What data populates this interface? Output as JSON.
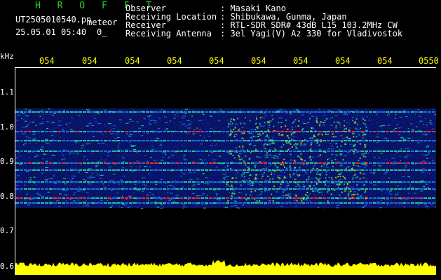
{
  "header": {
    "title": "H R O F F T",
    "file": "UT2505010540.pn",
    "mode": "meteor",
    "datetime": "25.05.01 05:40",
    "counter": "0_",
    "fields": [
      {
        "label": "Observer",
        "value": ": Masaki Kano"
      },
      {
        "label": "Receiving Location",
        "value": ": Shibukawa, Gunma, Japan"
      },
      {
        "label": "Receiver",
        "value": ": RTL-SDR SDR# 43dB L15 103.2MHz CW"
      },
      {
        "label": "Receiving Antenna",
        "value": ": 3el Yagi(V) Az 330 for Vladivostok"
      }
    ]
  },
  "axis": {
    "unit": "kHz",
    "x_ticks": [
      "054",
      "054",
      "054",
      "054",
      "054",
      "054",
      "054",
      "054",
      "054",
      "0550"
    ],
    "y_ticks": [
      "1.1",
      "1.0",
      "0.9",
      "0.8",
      "0.7",
      "0.6"
    ]
  },
  "colors": {
    "background": "#000000",
    "noise_low": "#0a1a9c",
    "noise_mid": "#1e78e6",
    "signal": "#22d4a0",
    "strong": "#ff3030",
    "level_bar": "#ffff00"
  }
}
